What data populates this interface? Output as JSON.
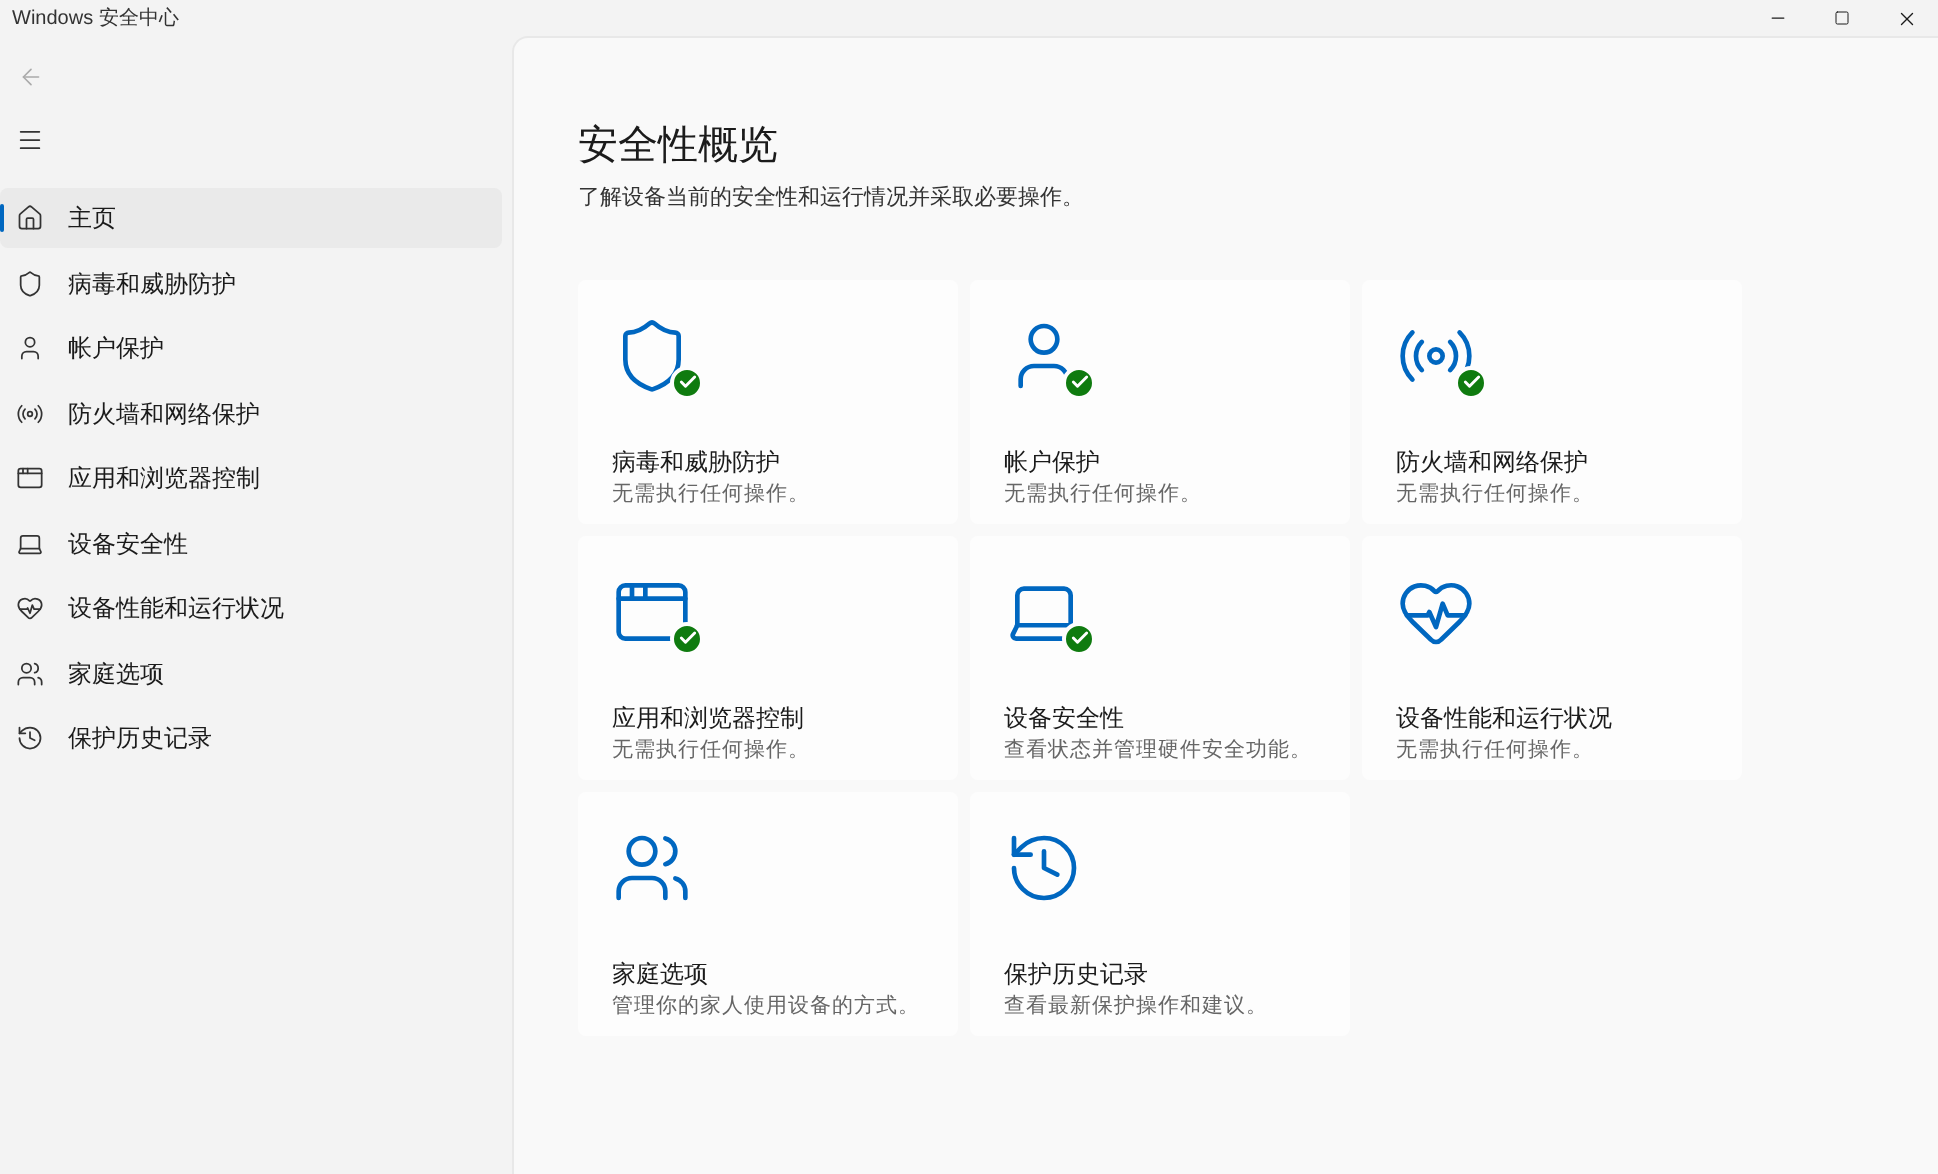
{
  "window": {
    "title": "Windows 安全中心"
  },
  "nav": [
    {
      "label": "主页",
      "kind": "home",
      "selected": true
    },
    {
      "label": "病毒和威胁防护",
      "kind": "shield",
      "selected": false
    },
    {
      "label": "帐户保护",
      "kind": "person",
      "selected": false
    },
    {
      "label": "防火墙和网络保护",
      "kind": "antenna",
      "selected": false
    },
    {
      "label": "应用和浏览器控制",
      "kind": "browser",
      "selected": false
    },
    {
      "label": "设备安全性",
      "kind": "laptop",
      "selected": false
    },
    {
      "label": "设备性能和运行状况",
      "kind": "heart",
      "selected": false
    },
    {
      "label": "家庭选项",
      "kind": "family",
      "selected": false
    },
    {
      "label": "保护历史记录",
      "kind": "history",
      "selected": false
    }
  ],
  "page": {
    "title": "安全性概览",
    "subtitle": "了解设备当前的安全性和运行情况并采取必要操作。"
  },
  "tiles": [
    {
      "title": "病毒和威胁防护",
      "description": "无需执行任何操作。",
      "kind": "shield",
      "ok": true
    },
    {
      "title": "帐户保护",
      "description": "无需执行任何操作。",
      "kind": "person",
      "ok": true
    },
    {
      "title": "防火墙和网络保护",
      "description": "无需执行任何操作。",
      "kind": "antenna",
      "ok": true
    },
    {
      "title": "应用和浏览器控制",
      "description": "无需执行任何操作。",
      "kind": "browser",
      "ok": true
    },
    {
      "title": "设备安全性",
      "description": "查看状态并管理硬件安全功能。",
      "kind": "laptop",
      "ok": true
    },
    {
      "title": "设备性能和运行状况",
      "description": "无需执行任何操作。",
      "kind": "heart",
      "ok": false
    },
    {
      "title": "家庭选项",
      "description": "管理你的家人使用设备的方式。",
      "kind": "family",
      "ok": false
    },
    {
      "title": "保护历史记录",
      "description": "查看最新保护操作和建议。",
      "kind": "history",
      "ok": false
    }
  ]
}
